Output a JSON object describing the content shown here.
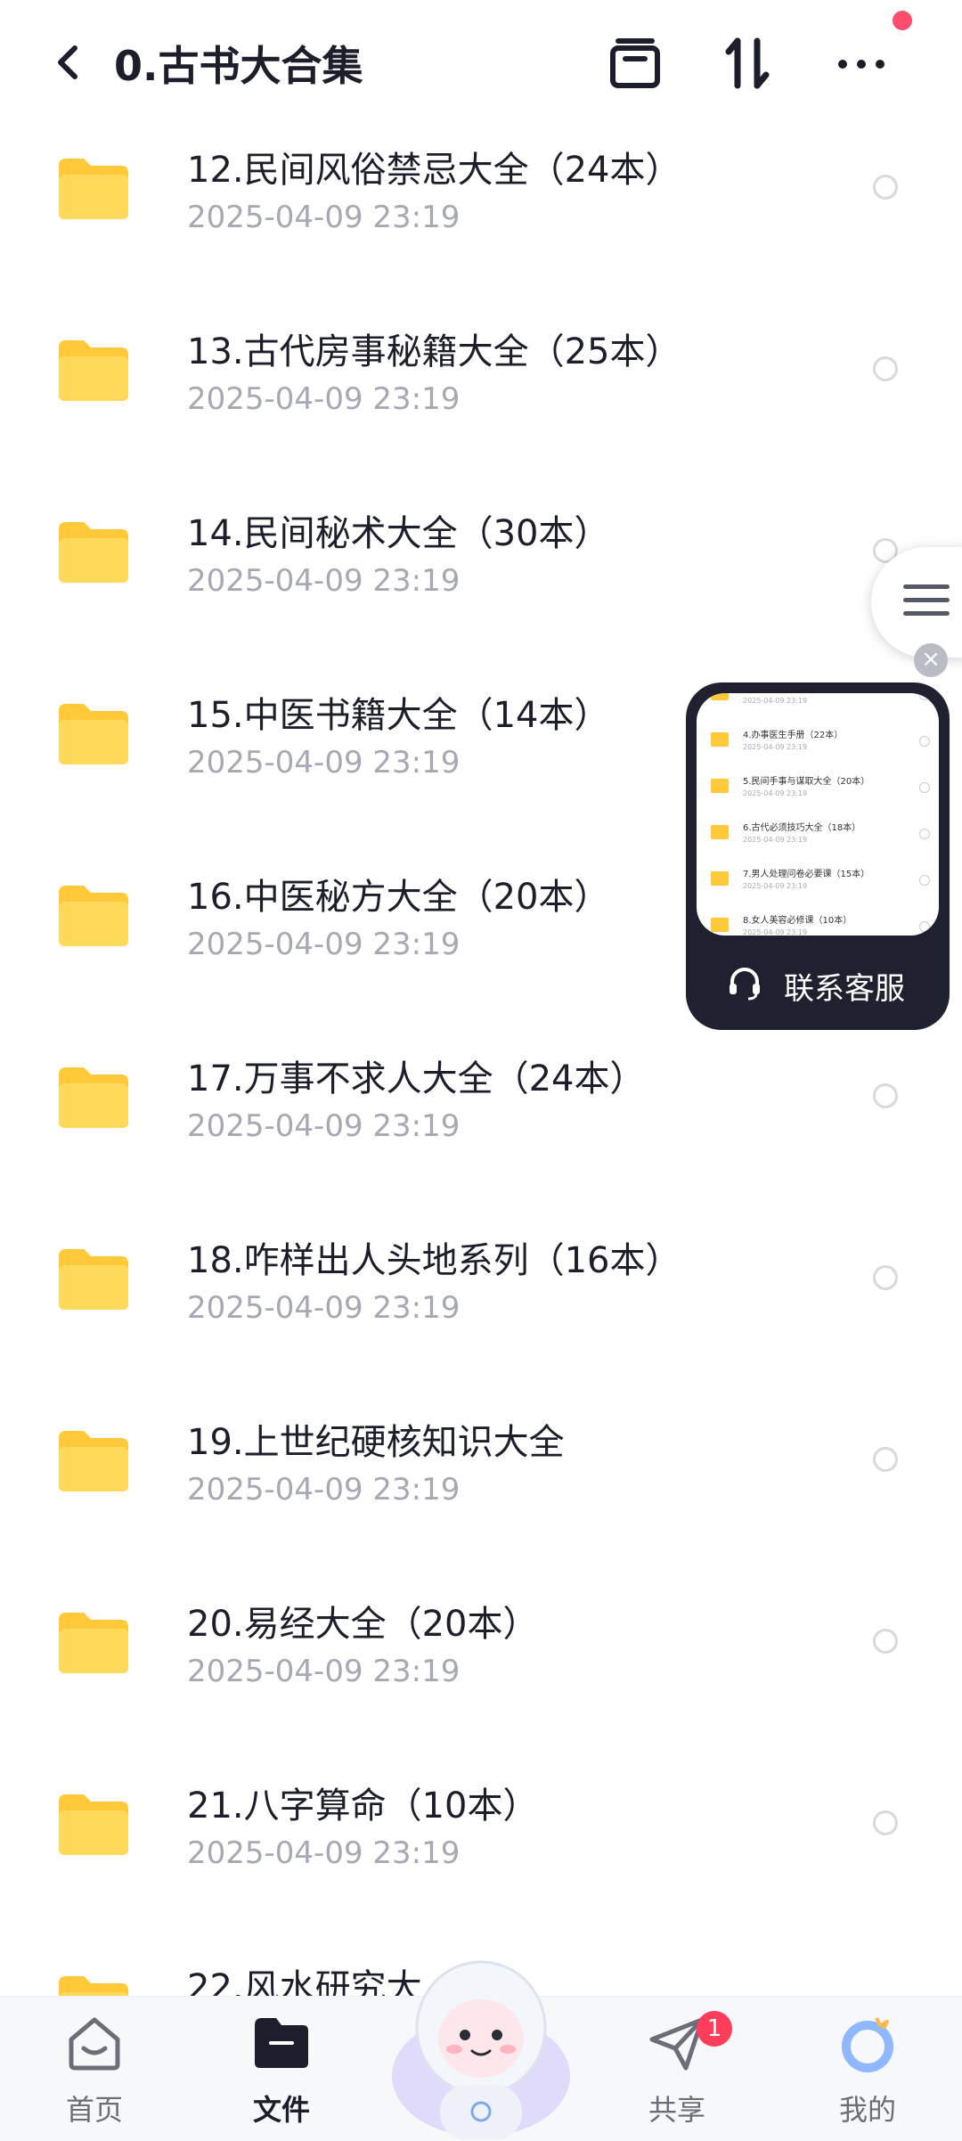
{
  "header": {
    "title": "0.古书大合集",
    "icons": [
      "back-icon",
      "archive-icon",
      "sort-icon",
      "more-icon"
    ],
    "notification_dot_color": "#ff4d6d"
  },
  "files": [
    {
      "name": "12.民间风俗禁忌大全（24本）",
      "date": "2025-04-09  23:19"
    },
    {
      "name": "13.古代房事秘籍大全（25本）",
      "date": "2025-04-09  23:19"
    },
    {
      "name": "14.民间秘术大全（30本）",
      "date": "2025-04-09  23:19"
    },
    {
      "name": "15.中医书籍大全（14本）",
      "date": "2025-04-09  23:19"
    },
    {
      "name": "16.中医秘方大全（20本）",
      "date": "2025-04-09  23:19"
    },
    {
      "name": "17.万事不求人大全（24本）",
      "date": "2025-04-09  23:19"
    },
    {
      "name": "18.咋样出人头地系列（16本）",
      "date": "2025-04-09  23:19"
    },
    {
      "name": "19.上世纪硬核知识大全",
      "date": "2025-04-09  23:19"
    },
    {
      "name": "20.易经大全（20本）",
      "date": "2025-04-09  23:19"
    },
    {
      "name": "21.八字算命（10本）",
      "date": "2025-04-09  23:19"
    },
    {
      "name": "22.风水研究大",
      "date": ""
    }
  ],
  "support_widget": {
    "label": "联系客服",
    "preview_rows": [
      {
        "name": "",
        "date": "2025-04-09  23:19"
      },
      {
        "name": "4.办事医生手册（22本）",
        "date": "2025-04-09  23:19"
      },
      {
        "name": "5.民间手事与谋取大全（20本）",
        "date": "2025-04-09  23:19"
      },
      {
        "name": "6.古代必须技巧大全（18本）",
        "date": "2025-04-09  23:19"
      },
      {
        "name": "7.男人处理问卷必要课（15本）",
        "date": "2025-04-09  23:19"
      },
      {
        "name": "8.女人美容必修课（10本）",
        "date": "2025-04-09  23:19"
      }
    ]
  },
  "tabbar": {
    "tabs": [
      {
        "label": "首页",
        "icon": "home-icon"
      },
      {
        "label": "文件",
        "icon": "folder-icon",
        "active": true
      },
      {
        "label": "共享",
        "icon": "send-icon",
        "badge": "1"
      },
      {
        "label": "我的",
        "icon": "profile-icon"
      }
    ]
  },
  "colors": {
    "folder": "#ffc93a",
    "badge": "#ff3d5a",
    "support_bg": "#1f2130"
  }
}
